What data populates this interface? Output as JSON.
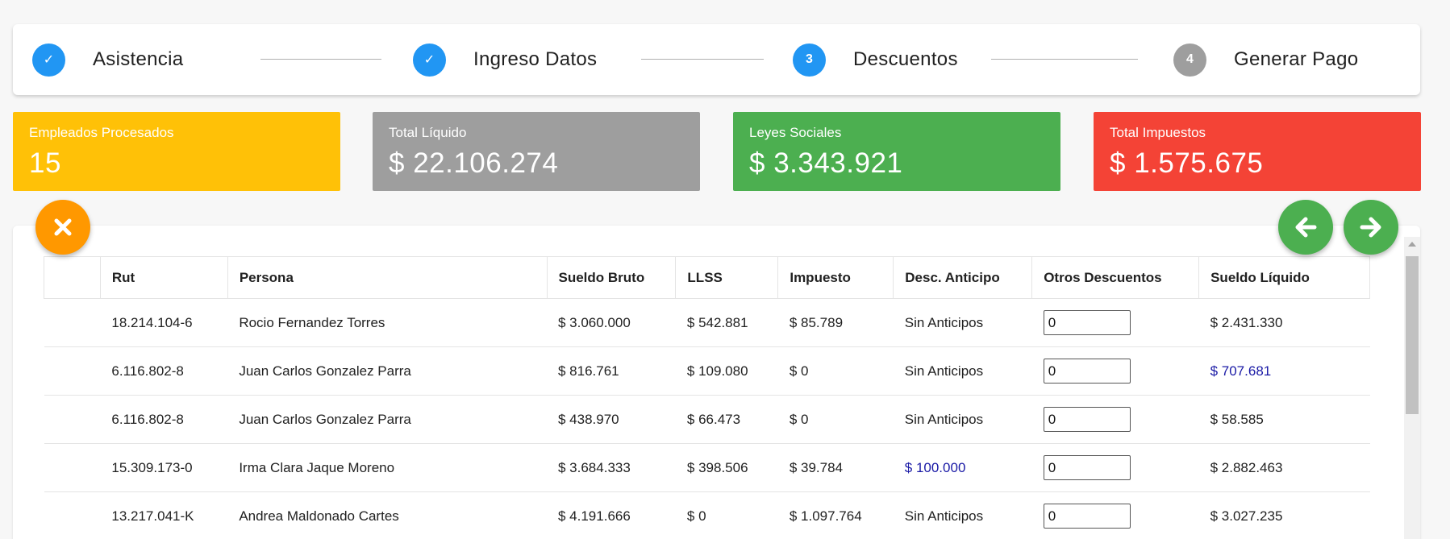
{
  "stepper": {
    "steps": [
      {
        "label": "Asistencia",
        "marker": "✓",
        "color": "#2196f3",
        "state": "completed"
      },
      {
        "label": "Ingreso Datos",
        "marker": "✓",
        "color": "#2196f3",
        "state": "completed"
      },
      {
        "label": "Descuentos",
        "marker": "3",
        "color": "#2196f3",
        "state": "active"
      },
      {
        "label": "Generar Pago",
        "marker": "4",
        "color": "#9e9e9e",
        "state": "pending"
      }
    ]
  },
  "stats": [
    {
      "title": "Empleados Procesados",
      "value": "15",
      "color": "#ffc107"
    },
    {
      "title": "Total Líquido",
      "value": "$ 22.106.274",
      "color": "#9e9e9e"
    },
    {
      "title": "Leyes Sociales",
      "value": "$ 3.343.921",
      "color": "#4caf50"
    },
    {
      "title": "Total Impuestos",
      "value": "$ 1.575.675",
      "color": "#f44336"
    }
  ],
  "actions": {
    "cancel_icon": "close-icon",
    "cancel_color": "#ff9800",
    "prev_icon": "arrow-left-icon",
    "next_icon": "arrow-right-icon",
    "nav_color": "#4caf50"
  },
  "table": {
    "headers": [
      "",
      "Rut",
      "Persona",
      "Sueldo Bruto",
      "LLSS",
      "Impuesto",
      "Desc. Anticipo",
      "Otros Descuentos",
      "Sueldo Líquido"
    ],
    "link_color": "#1a1aa6",
    "rows": [
      {
        "rut": "18.214.104-6",
        "persona": "Rocio Fernandez Torres",
        "bruto": "$ 3.060.000",
        "llss": "$ 542.881",
        "impuesto": "$ 85.789",
        "anticipo": "Sin Anticipos",
        "otros": "0",
        "liquido": "$ 2.431.330"
      },
      {
        "rut": "6.116.802-8",
        "persona": "Juan Carlos Gonzalez Parra",
        "bruto": "$ 816.761",
        "llss": "$ 109.080",
        "impuesto": "$ 0",
        "anticipo": "Sin Anticipos",
        "otros": "0",
        "liquido": "$ 707.681"
      },
      {
        "rut": "6.116.802-8",
        "persona": "Juan Carlos Gonzalez Parra",
        "bruto": "$ 438.970",
        "llss": "$ 66.473",
        "impuesto": "$ 0",
        "anticipo": "Sin Anticipos",
        "otros": "0",
        "liquido": "$ 58.585"
      },
      {
        "rut": "15.309.173-0",
        "persona": "Irma Clara Jaque Moreno",
        "bruto": "$ 3.684.333",
        "llss": "$ 398.506",
        "impuesto": "$ 39.784",
        "anticipo": "$ 100.000",
        "otros": "0",
        "liquido": "$ 2.882.463"
      },
      {
        "rut": "13.217.041-K",
        "persona": "Andrea Maldonado Cartes",
        "bruto": "$ 4.191.666",
        "llss": "$ 0",
        "impuesto": "$ 1.097.764",
        "anticipo": "Sin Anticipos",
        "otros": "0",
        "liquido": "$ 3.027.235"
      }
    ]
  }
}
